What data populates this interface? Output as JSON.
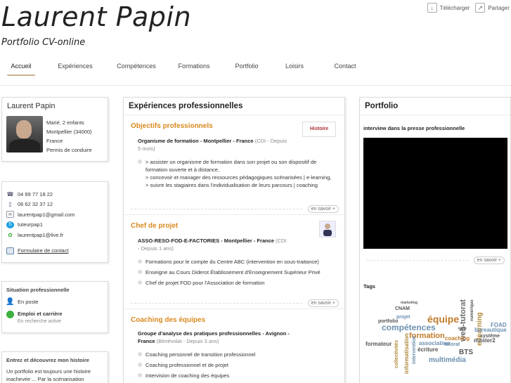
{
  "header": {
    "title": "Laurent Papin",
    "subtitle": "Portfolio CV-online",
    "actions": [
      {
        "label": "Télécharger",
        "icon": "download-icon"
      },
      {
        "label": "Partager",
        "icon": "share-icon"
      }
    ]
  },
  "nav": {
    "items": [
      "Accueil",
      "Expériences",
      "Compétences",
      "Formations",
      "Portfolio",
      "Loisirs",
      "Contact"
    ],
    "active": "Accueil"
  },
  "profile": {
    "name": "Laurent Papin",
    "lines": [
      "Marié, 2 enfants",
      "Montpellier (34000)",
      "France",
      "Permis de conduire"
    ]
  },
  "contact": {
    "phone1": "04 99 77 18 22",
    "phone2": "06 62 32 37 12",
    "email": "laurentpap1@gmail.com",
    "skype": "tuteurpap1",
    "msn": "laurentpap1@live.fr",
    "form_label": "Formulaire de contact"
  },
  "status": {
    "title": "Situation professionnelle",
    "position": "En poste",
    "career_label": "Emploi et carrière",
    "career_sub": "En recherche active"
  },
  "story": {
    "title": "Entrez et découvrez mon histoire",
    "text_1": "Un portfolio est toujours une histoire",
    "text_2": "inachevée ... Par la scénarisation"
  },
  "experiences": {
    "title": "Expériences professionnelles",
    "more_label": "en savoir +",
    "sections": [
      {
        "title": "Objectifs professionnels",
        "thumb_label": "Histoire",
        "org": "Organisme de formation - Montpellier - France",
        "meta_1": "(CDI - Depuis",
        "meta_2": "5 mois)",
        "bullets": [
          "> assister un organisme de formation dans son projet ou son dispositif de formation ouverte et à distance,",
          "> concevoir et manager des ressources pédagogiques scénarisées | e-learning,",
          "> suivre les stagiaires dans l'individualisation de leurs parcours | coaching"
        ]
      },
      {
        "title": "Chef de projet",
        "org": "ASSO-RESO-FOD-E-FACTORIES - Montpellier - France",
        "meta_1": "(CDI",
        "meta_2": "- Depuis 1 ans)",
        "bullets": [
          "Formations pour le compte du Centre ABC (intervention en sous-traitance)",
          "Enseigne au Cours Diderot Établissement d'Enseignement Supérieur Privé",
          "Chef de projet FOD pour l'Association de formation"
        ]
      },
      {
        "title": "Coaching des équipes",
        "org_1": "Groupe d'analyse des pratiques professionnelles - Avignon -",
        "org_2": "France",
        "meta": "(Bénévolat - Depuis 3 ans)",
        "bullets": [
          "Coaching personnel de transition professionnel",
          "Coaching professionnel et de projet",
          "Intervision de coaching des équipes"
        ]
      }
    ]
  },
  "portfolio": {
    "title": "Portfolio",
    "video_title": "interview dans la presse professionnelle",
    "tags_title": "Tags",
    "tags": [
      {
        "text": "compétences",
        "color": "#6b8fb0"
      },
      {
        "text": "équipe",
        "color": "#c07a2a"
      },
      {
        "text": "web-tutorat",
        "color": "#6a6a6a"
      },
      {
        "text": "e-learning",
        "color": "#b08a3a"
      },
      {
        "text": "formation",
        "color": "#c07a2a"
      },
      {
        "text": "projet",
        "color": "#6b8fb0"
      },
      {
        "text": "FOAD",
        "color": "#6b8fb0"
      },
      {
        "text": "bureautique",
        "color": "#6b8fb0"
      },
      {
        "text": "système",
        "color": "#555555"
      },
      {
        "text": "master2",
        "color": "#555555"
      },
      {
        "text": "BTS",
        "color": "#555555"
      },
      {
        "text": "multimédia",
        "color": "#6b8fb0"
      },
      {
        "text": "portfolio",
        "color": "#555555"
      },
      {
        "text": "formateur",
        "color": "#555555"
      },
      {
        "text": "informatisation",
        "color": "#b08a3a"
      },
      {
        "text": "CNAM",
        "color": "#555555"
      },
      {
        "text": "écriture",
        "color": "#555555"
      },
      {
        "text": "collectivités",
        "color": "#b08a3a"
      },
      {
        "text": "coaching",
        "color": "#c07a2a"
      },
      {
        "text": "association",
        "color": "#6b8fb0"
      },
      {
        "text": "numérique",
        "color": "#555555"
      },
      {
        "text": "intervention",
        "color": "#6b8fb0"
      },
      {
        "text": "tutorat",
        "color": "#6b8fb0"
      },
      {
        "text": "web",
        "color": "#555555"
      },
      {
        "text": "marketing",
        "color": "#555555"
      }
    ]
  }
}
